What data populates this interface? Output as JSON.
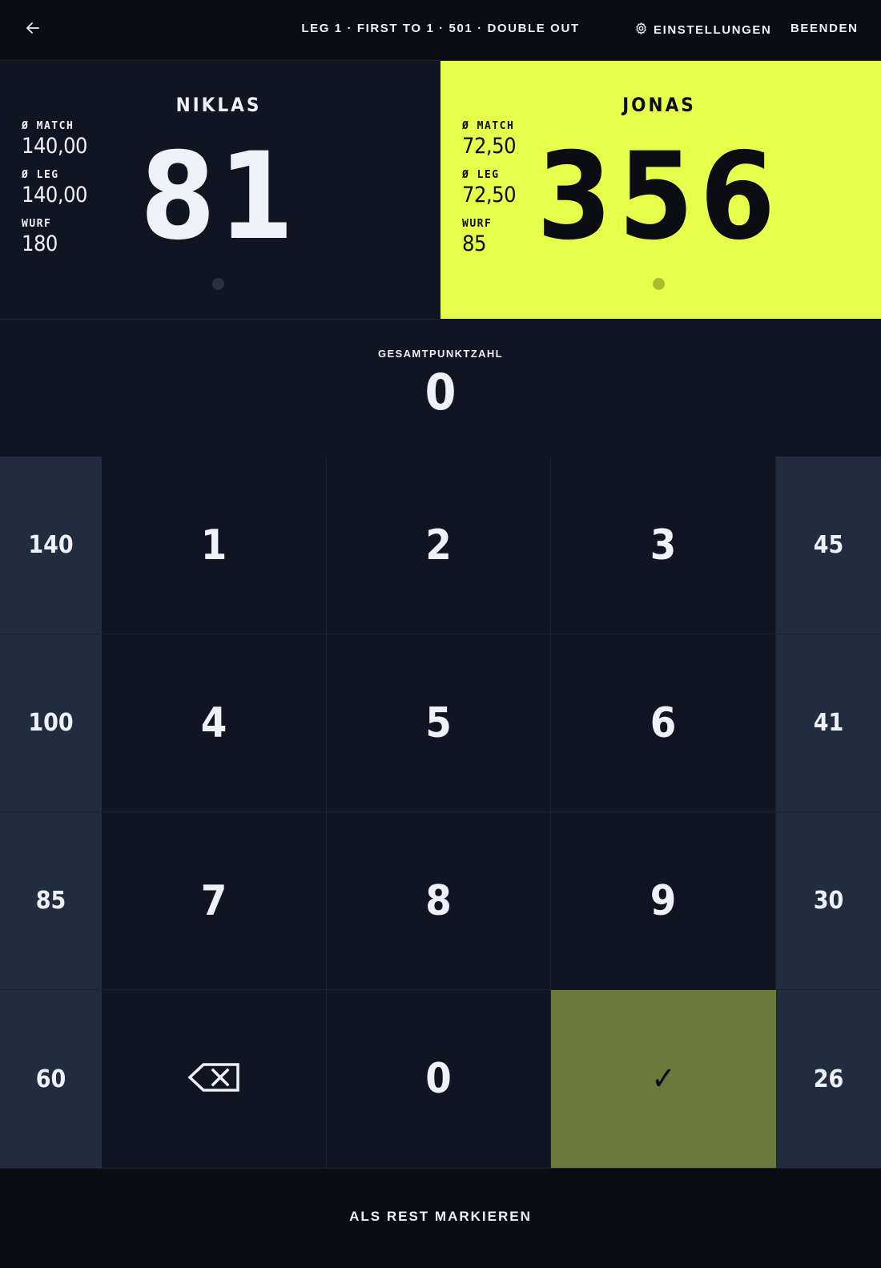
{
  "header": {
    "back_icon": "arrow-left-icon",
    "match_info": "LEG 1 · FIRST TO 1 · 501 · DOUBLE OUT",
    "settings_icon": "gear-icon",
    "settings_label": "EINSTELLUNGEN",
    "end_label": "BEENDEN"
  },
  "players": [
    {
      "name": "NIKLAS",
      "score": "81",
      "stats": [
        {
          "label": "Ø MATCH",
          "value": "140,00"
        },
        {
          "label": "Ø LEG",
          "value": "140,00"
        },
        {
          "label": "WURF",
          "value": "180"
        }
      ],
      "active": false
    },
    {
      "name": "JONAS",
      "score": "356",
      "stats": [
        {
          "label": "Ø MATCH",
          "value": "72,50"
        },
        {
          "label": "Ø LEG",
          "value": "72,50"
        },
        {
          "label": "WURF",
          "value": "85"
        }
      ],
      "active": true
    }
  ],
  "total": {
    "label": "GESAMTPUNKTZAHL",
    "value": "0"
  },
  "keypad": {
    "quick_left": [
      "140",
      "100",
      "85",
      "60"
    ],
    "quick_right": [
      "45",
      "41",
      "30",
      "26"
    ],
    "digits": [
      "1",
      "2",
      "3",
      "4",
      "5",
      "6",
      "7",
      "8",
      "9"
    ],
    "zero": "0",
    "backspace_icon": "backspace-icon",
    "confirm_icon": "checkmark-icon",
    "confirm_glyph": "✓"
  },
  "footer": {
    "mark_rest_label": "ALS REST MARKIEREN"
  },
  "colors": {
    "background": "#111521",
    "header_bg": "#0b0d13",
    "active_player_bg": "#e6ff4a",
    "quick_key_bg": "#222c40",
    "confirm_bg": "#6d793b"
  }
}
